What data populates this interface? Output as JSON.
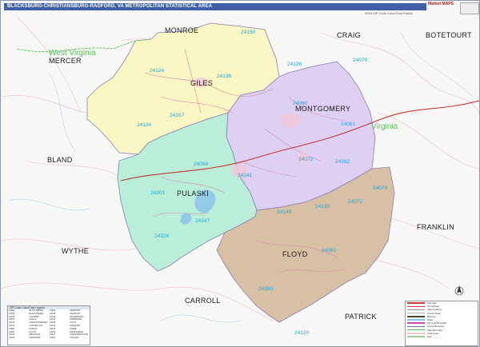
{
  "title": "BLACKSBURG-CHRISTIANSBURG-RADFORD, VA METROPOLITAN STATISTICAL AREA",
  "subtitle": "2023 ZIP Code Color/Cast Edition",
  "logo_text": "Market MAPS",
  "states": [
    "West Virginia",
    "Virginia"
  ],
  "counties_msa": [
    "GILES",
    "MONTGOMERY",
    "PULASKI",
    "FLOYD"
  ],
  "counties_neighbor": [
    "MONROE",
    "MERCER",
    "CRAIG",
    "BOTETOURT",
    "BLAND",
    "WYTHE",
    "CARROLL",
    "PATRICK",
    "FRANKLIN"
  ],
  "colors": {
    "giles": "#fbf7c4",
    "montgomery": "#ddd0f3",
    "pulaski": "#b9efd9",
    "floyd": "#d8c0a5",
    "background": "#f7f7f5",
    "title_bar": "#3f5fa6",
    "zip_label": "#1aa6d9",
    "state_label": "#57c257"
  },
  "zip_codes": [
    "24150",
    "24126",
    "24070",
    "24124",
    "24136",
    "24167",
    "24134",
    "24060",
    "24061",
    "24073",
    "24382",
    "24084",
    "24141",
    "24301",
    "24347",
    "24324",
    "24149",
    "24138",
    "24072",
    "24079",
    "24091",
    "24380",
    "24120"
  ],
  "zip_table": {
    "title": "ZIP Code Color/Cast Legend",
    "rows": [
      [
        "24060",
        "BLACKSBURG",
        "24126",
        "NEWPORT"
      ],
      [
        "24061",
        "BLACKSBURG",
        "24128",
        "NEWPORT"
      ],
      [
        "24070",
        "CATAWBA",
        "24134",
        "PEARISBURG"
      ],
      [
        "24072",
        "CHECK",
        "24136",
        "PEMBROKE"
      ],
      [
        "24073",
        "CHRISTIANSBURG",
        "24138",
        "PILOT"
      ],
      [
        "24079",
        "COPPER HILL",
        "24141",
        "RADFORD"
      ],
      [
        "24084",
        "DUBLIN",
        "24149",
        "RINER"
      ],
      [
        "24091",
        "FLOYD",
        "24150",
        "RIPPLEMEAD"
      ],
      [
        "24120",
        "MEADOWS",
        "24167",
        "STAFFORDSVILLE"
      ],
      [
        "24124",
        "NARROWS",
        "24301",
        "PULASKI"
      ]
    ]
  },
  "legend": {
    "items": [
      "Interstate",
      "US Highway",
      "State Highway",
      "County Road",
      "Railroad",
      "Water",
      "ZIP Code Boundary",
      "County Boundary",
      "State Boundary",
      "Urban Area",
      "Park"
    ],
    "swatch_colors": [
      "#d23a3a",
      "#d23a3a",
      "#8a8a8a",
      "#b0b0b0",
      "#444444",
      "#7ec4f0",
      "#c84fb0",
      "#777777",
      "#57c257",
      "#f0c8c8",
      "#9ad08a"
    ]
  }
}
